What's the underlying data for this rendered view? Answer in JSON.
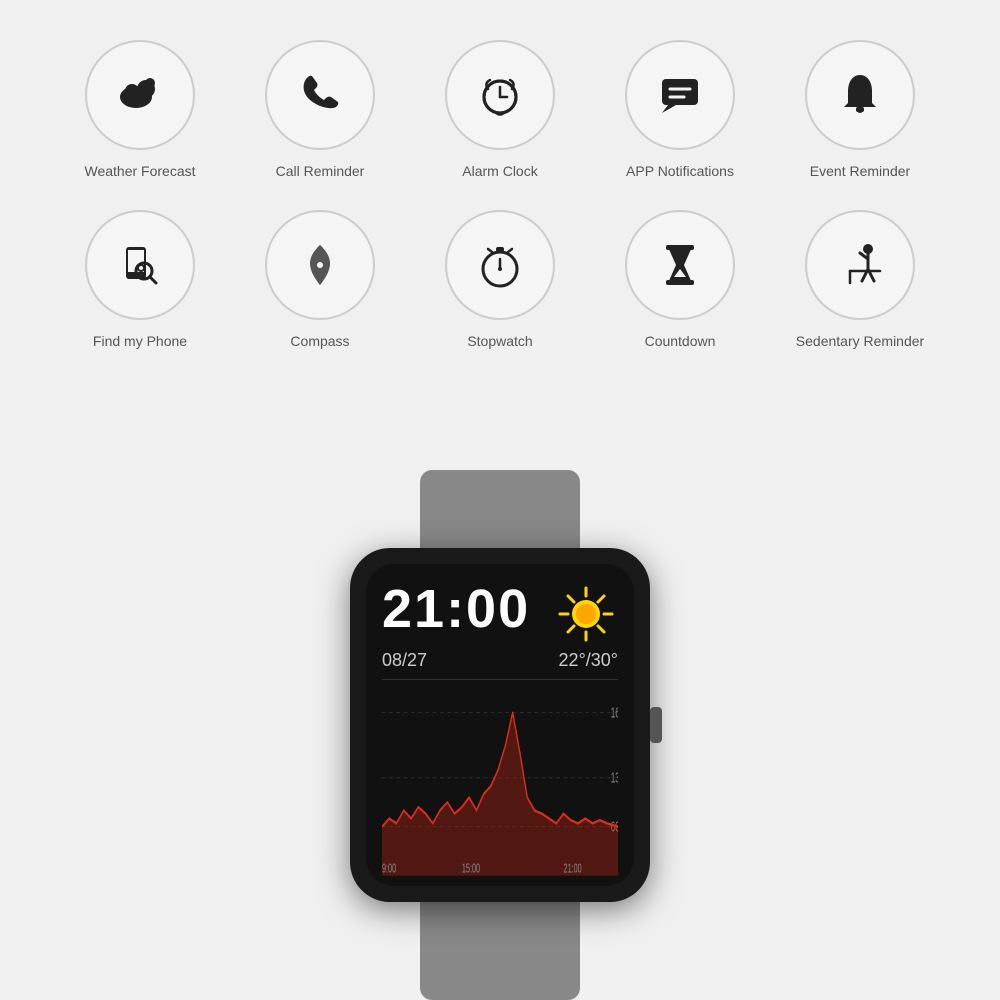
{
  "features": {
    "row1": [
      {
        "id": "weather-forecast",
        "label": "Weather Forecast",
        "icon": "weather"
      },
      {
        "id": "call-reminder",
        "label": "Call Reminder",
        "icon": "call"
      },
      {
        "id": "alarm-clock",
        "label": "Alarm Clock",
        "icon": "alarm"
      },
      {
        "id": "app-notifications",
        "label": "APP Notifications",
        "icon": "notification"
      },
      {
        "id": "event-reminder",
        "label": "Event Reminder",
        "icon": "bell"
      }
    ],
    "row2": [
      {
        "id": "find-my-phone",
        "label": "Find my Phone",
        "icon": "phone-search"
      },
      {
        "id": "compass",
        "label": "Compass",
        "icon": "compass"
      },
      {
        "id": "stopwatch",
        "label": "Stopwatch",
        "icon": "stopwatch"
      },
      {
        "id": "countdown",
        "label": "Countdown",
        "icon": "countdown"
      },
      {
        "id": "sedentary-reminder",
        "label": "Sedentary Reminder",
        "icon": "sedentary"
      }
    ]
  },
  "watch": {
    "time": "21:00",
    "date": "08/27",
    "temp": "22°/30°"
  }
}
